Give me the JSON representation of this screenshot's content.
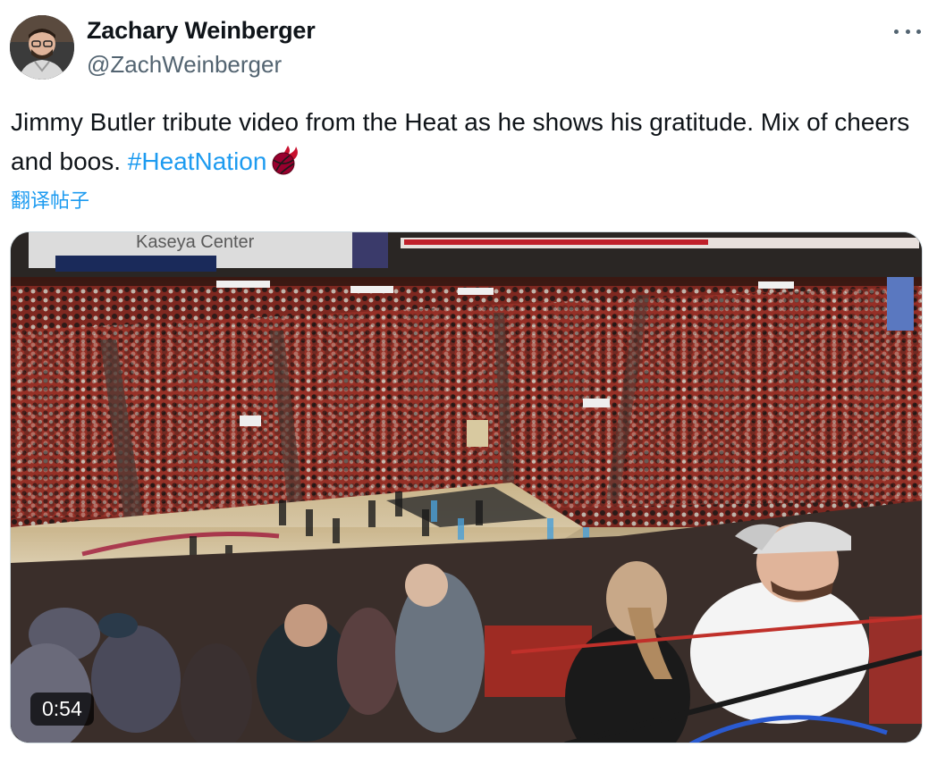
{
  "author": {
    "name": "Zachary Weinberger",
    "handle": "@ZachWeinberger",
    "avatar_icon": "profile-photo"
  },
  "more_icon": "more-options-icon",
  "post": {
    "text": "Jimmy Butler tribute video from the Heat as he shows his gratitude. Mix of cheers and boos. ",
    "hashtag": "#HeatNation",
    "emoji_icon": "basketball-flame-icon"
  },
  "translate_label": "翻译帖子",
  "media": {
    "type": "video",
    "duration": "0:54",
    "arena_sign": "Kaseya Center"
  },
  "colors": {
    "link": "#1d9bf0",
    "secondary_text": "#536471",
    "heat_red": "#98002e"
  }
}
